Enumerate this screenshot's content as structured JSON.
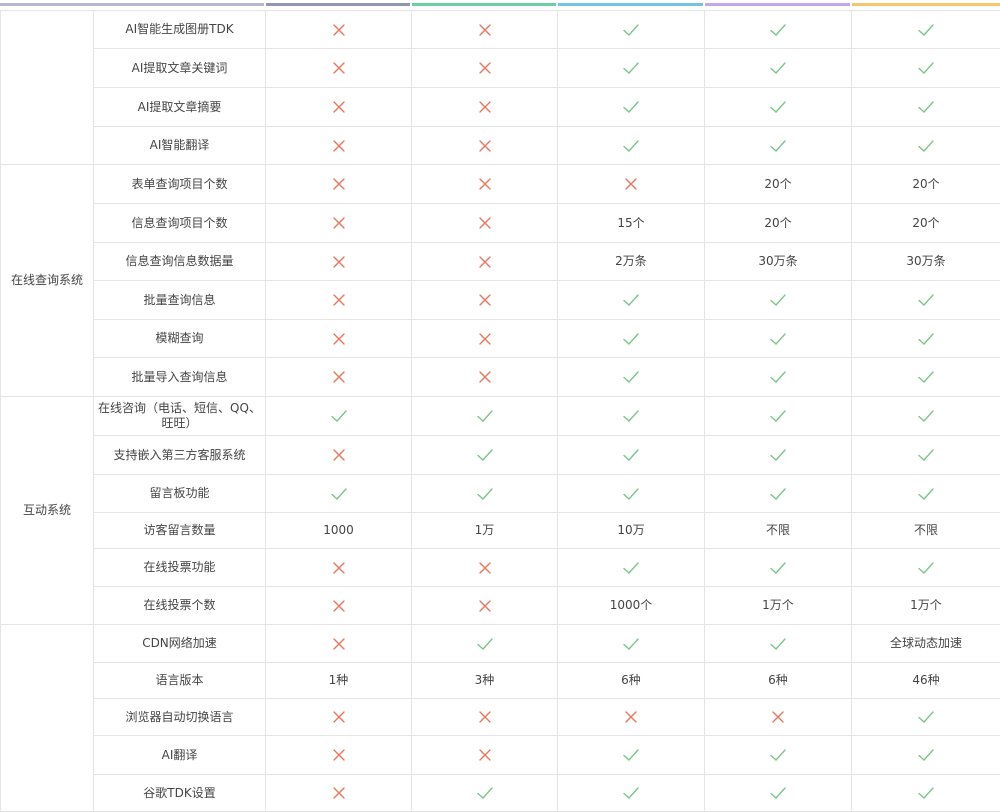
{
  "colors": {
    "check": "#7cc58a",
    "cross": "#e9755c",
    "border": "#e4e4e4",
    "top_bars": [
      "#b6b6d6",
      "#8f96b2",
      "#6ad0a3",
      "#72c4e6",
      "#c3a6ee",
      "#f9c46e"
    ]
  },
  "icons": {
    "yes": "check-icon",
    "no": "cross-icon"
  },
  "groups": [
    {
      "label": "",
      "rows": [
        {
          "feature": "AI智能生成图册TDK",
          "cells": [
            "x",
            "x",
            "v",
            "v",
            "v"
          ]
        },
        {
          "feature": "AI提取文章关键词",
          "cells": [
            "x",
            "x",
            "v",
            "v",
            "v"
          ]
        },
        {
          "feature": "AI提取文章摘要",
          "cells": [
            "x",
            "x",
            "v",
            "v",
            "v"
          ]
        },
        {
          "feature": "AI智能翻译",
          "cells": [
            "x",
            "x",
            "v",
            "v",
            "v"
          ]
        }
      ]
    },
    {
      "label": "在线查询系统",
      "rows": [
        {
          "feature": "表单查询项目个数",
          "cells": [
            "x",
            "x",
            "x",
            "20个",
            "20个"
          ]
        },
        {
          "feature": "信息查询项目个数",
          "cells": [
            "x",
            "x",
            "15个",
            "20个",
            "20个"
          ]
        },
        {
          "feature": "信息查询信息数据量",
          "cells": [
            "x",
            "x",
            "2万条",
            "30万条",
            "30万条"
          ]
        },
        {
          "feature": "批量查询信息",
          "cells": [
            "x",
            "x",
            "v",
            "v",
            "v"
          ]
        },
        {
          "feature": "模糊查询",
          "cells": [
            "x",
            "x",
            "v",
            "v",
            "v"
          ]
        },
        {
          "feature": "批量导入查询信息",
          "cells": [
            "x",
            "x",
            "v",
            "v",
            "v"
          ]
        }
      ]
    },
    {
      "label": "互动系统",
      "rows": [
        {
          "feature": "在线咨询（电话、短信、QQ、旺旺）",
          "cells": [
            "v",
            "v",
            "v",
            "v",
            "v"
          ]
        },
        {
          "feature": "支持嵌入第三方客服系统",
          "cells": [
            "x",
            "v",
            "v",
            "v",
            "v"
          ]
        },
        {
          "feature": "留言板功能",
          "cells": [
            "v",
            "v",
            "v",
            "v",
            "v"
          ]
        },
        {
          "feature": "访客留言数量",
          "cells": [
            "1000",
            "1万",
            "10万",
            "不限",
            "不限"
          ]
        },
        {
          "feature": "在线投票功能",
          "cells": [
            "x",
            "x",
            "v",
            "v",
            "v"
          ]
        },
        {
          "feature": "在线投票个数",
          "cells": [
            "x",
            "x",
            "1000个",
            "1万个",
            "1万个"
          ]
        }
      ]
    },
    {
      "label": "",
      "rows": [
        {
          "feature": "CDN网络加速",
          "cells": [
            "x",
            "v",
            "v",
            "v",
            "全球动态加速"
          ]
        },
        {
          "feature": "语言版本",
          "cells": [
            "1种",
            "3种",
            "6种",
            "6种",
            "46种"
          ]
        },
        {
          "feature": "浏览器自动切换语言",
          "cells": [
            "x",
            "x",
            "x",
            "x",
            "v"
          ]
        },
        {
          "feature": "AI翻译",
          "cells": [
            "x",
            "x",
            "v",
            "v",
            "v"
          ]
        },
        {
          "feature": "谷歌TDK设置",
          "cells": [
            "x",
            "v",
            "v",
            "v",
            "v"
          ]
        }
      ]
    }
  ]
}
